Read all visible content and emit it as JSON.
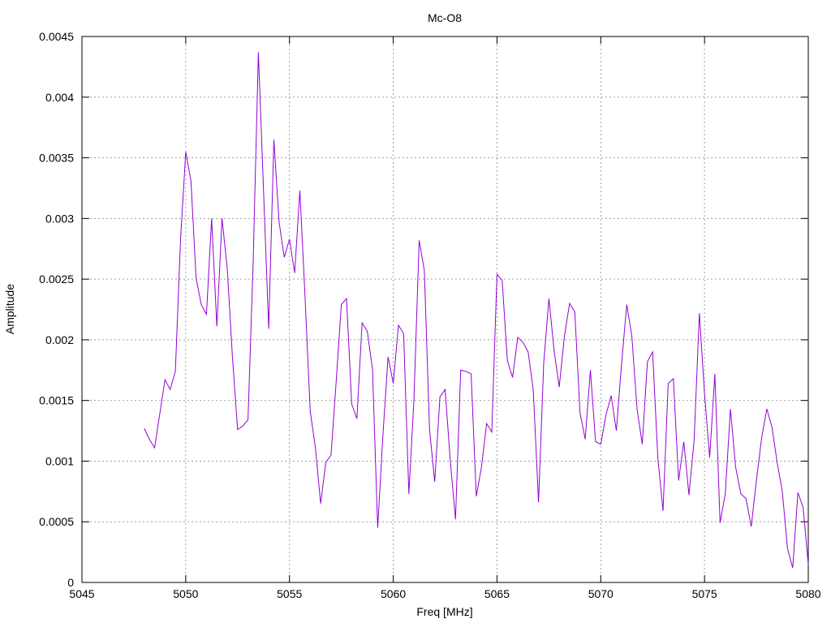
{
  "chart_data": {
    "type": "line",
    "title": "Mc-O8",
    "xlabel": "Freq [MHz]",
    "ylabel": "Amplitude",
    "xlim": [
      5045,
      5080
    ],
    "ylim": [
      0,
      0.0045
    ],
    "grid": true,
    "x_ticks": [
      "5045",
      "5050",
      "5055",
      "5060",
      "5065",
      "5070",
      "5075",
      "5080"
    ],
    "y_ticks": [
      "0",
      "0.0005",
      "0.001",
      "0.0015",
      "0.002",
      "0.0025",
      "0.003",
      "0.0035",
      "0.004",
      "0.0045"
    ],
    "series": [
      {
        "color": "#9400d3",
        "x": [
          5048.0,
          5048.25,
          5048.5,
          5048.75,
          5049.0,
          5049.25,
          5049.5,
          5049.75,
          5050.0,
          5050.25,
          5050.5,
          5050.75,
          5051.0,
          5051.25,
          5051.5,
          5051.75,
          5052.0,
          5052.25,
          5052.5,
          5052.75,
          5053.0,
          5053.25,
          5053.5,
          5053.75,
          5054.0,
          5054.25,
          5054.5,
          5054.75,
          5055.0,
          5055.25,
          5055.5,
          5055.75,
          5056.0,
          5056.25,
          5056.5,
          5056.75,
          5057.0,
          5057.25,
          5057.5,
          5057.75,
          5058.0,
          5058.25,
          5058.5,
          5058.75,
          5059.0,
          5059.25,
          5059.5,
          5059.75,
          5060.0,
          5060.25,
          5060.5,
          5060.75,
          5061.0,
          5061.25,
          5061.5,
          5061.75,
          5062.0,
          5062.25,
          5062.5,
          5062.75,
          5063.0,
          5063.25,
          5063.5,
          5063.75,
          5064.0,
          5064.25,
          5064.5,
          5064.75,
          5065.0,
          5065.25,
          5065.5,
          5065.75,
          5066.0,
          5066.25,
          5066.5,
          5066.75,
          5067.0,
          5067.25,
          5067.5,
          5067.75,
          5068.0,
          5068.25,
          5068.5,
          5068.75,
          5069.0,
          5069.25,
          5069.5,
          5069.75,
          5070.0,
          5070.25,
          5070.5,
          5070.75,
          5071.0,
          5071.25,
          5071.5,
          5071.75,
          5072.0,
          5072.25,
          5072.5,
          5072.75,
          5073.0,
          5073.25,
          5073.5,
          5073.75,
          5074.0,
          5074.25,
          5074.5,
          5074.75,
          5075.0,
          5075.25,
          5075.5,
          5075.75,
          5076.0,
          5076.25,
          5076.5,
          5076.75,
          5077.0,
          5077.25,
          5077.5,
          5077.75,
          5078.0,
          5078.25,
          5078.5,
          5078.75,
          5079.0,
          5079.25,
          5079.5,
          5079.75,
          5080.0
        ],
        "y": [
          0.00127,
          0.00118,
          0.00111,
          0.00139,
          0.00167,
          0.00159,
          0.00174,
          0.00283,
          0.00355,
          0.00331,
          0.00251,
          0.00229,
          0.00221,
          0.003,
          0.00211,
          0.003,
          0.00259,
          0.00186,
          0.00126,
          0.00129,
          0.00134,
          0.00265,
          0.00437,
          0.00322,
          0.00209,
          0.00365,
          0.00297,
          0.00268,
          0.00283,
          0.00255,
          0.00323,
          0.00235,
          0.00141,
          0.00111,
          0.00065,
          0.00099,
          0.00105,
          0.00166,
          0.00229,
          0.00234,
          0.00147,
          0.00135,
          0.00214,
          0.00207,
          0.00176,
          0.00045,
          0.00121,
          0.00186,
          0.00164,
          0.00212,
          0.00205,
          0.00073,
          0.00151,
          0.00282,
          0.00257,
          0.00126,
          0.00083,
          0.00153,
          0.00159,
          0.001,
          0.00052,
          0.00175,
          0.00174,
          0.00172,
          0.00071,
          0.00095,
          0.00131,
          0.00124,
          0.00254,
          0.00249,
          0.00183,
          0.00169,
          0.00202,
          0.00198,
          0.0019,
          0.00158,
          0.00066,
          0.00181,
          0.00234,
          0.00191,
          0.00161,
          0.00203,
          0.0023,
          0.00223,
          0.0014,
          0.00118,
          0.00175,
          0.00116,
          0.00114,
          0.00138,
          0.00154,
          0.00125,
          0.0018,
          0.00229,
          0.00203,
          0.00143,
          0.00114,
          0.00182,
          0.0019,
          0.00103,
          0.00059,
          0.00164,
          0.00168,
          0.00084,
          0.00116,
          0.00072,
          0.00118,
          0.00222,
          0.00156,
          0.00103,
          0.00172,
          0.00049,
          0.00073,
          0.00143,
          0.00095,
          0.00073,
          0.00069,
          0.00046,
          0.00084,
          0.00119,
          0.00143,
          0.00128,
          0.00099,
          0.00075,
          0.00028,
          0.00012,
          0.00074,
          0.00062,
          0.00015
        ]
      }
    ]
  }
}
